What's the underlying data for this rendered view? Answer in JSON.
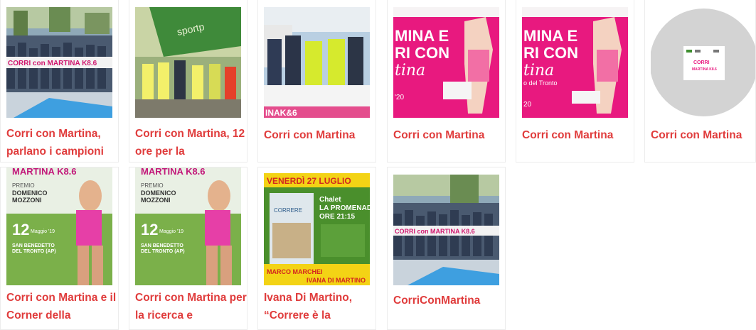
{
  "cards": [
    {
      "title": "Corri con Martina, parlano i campioni"
    },
    {
      "title": "Corri con Martina, 12 ore per la"
    },
    {
      "title": "Corri con Martina",
      "banner": "INAK&6"
    },
    {
      "title": "Corri con Martina",
      "poster_text": [
        "MINA E",
        "RI CON",
        "tina"
      ],
      "year": "'20"
    },
    {
      "title": "Corri con Martina",
      "poster_text": [
        "MINA E",
        "RI CON",
        "tina"
      ],
      "subtitle": "o del Tronto",
      "year": "20"
    },
    {
      "title": "Corri con Martina",
      "logo_text": [
        "CORRI",
        "MARTINA K8.6"
      ]
    },
    {
      "title": "Corri con Martina e il Corner della",
      "poster": {
        "top": "MARTINA K8.6",
        "premio": "PREMIO",
        "name1": "DOMENICO",
        "name2": "MOZZONI",
        "day": "12",
        "month": "Maggio '19",
        "place1": "SAN BENEDETTO",
        "place2": "DEL TRONTO (AP)"
      }
    },
    {
      "title": "Corri con Martina per la ricerca e",
      "poster": {
        "top": "MARTINA K8.6",
        "premio": "PREMIO",
        "name1": "DOMENICO",
        "name2": "MOZZONI",
        "day": "12",
        "month": "Maggio '19",
        "place1": "SAN BENEDETTO",
        "place2": "DEL TRONTO (AP)"
      }
    },
    {
      "title": "Ivana Di Martino, “Correre è la",
      "poster": {
        "header": "VENERDÌ 27 LUGLIO",
        "l1": "Chalet",
        "l2": "LA PROMENADE",
        "l3": "ORE 21:15",
        "book": "CORRERE",
        "author1": "MARCO MARCHEI",
        "author2": "IVANA DI MARTINO"
      }
    },
    {
      "title": "CorriConMartina",
      "banner": "CORRI con MARTINA K8.6"
    }
  ],
  "colors": {
    "title": "#e03c3c",
    "pink": "#e8197f",
    "green": "#3e8e2f",
    "yellow": "#f3d315"
  }
}
